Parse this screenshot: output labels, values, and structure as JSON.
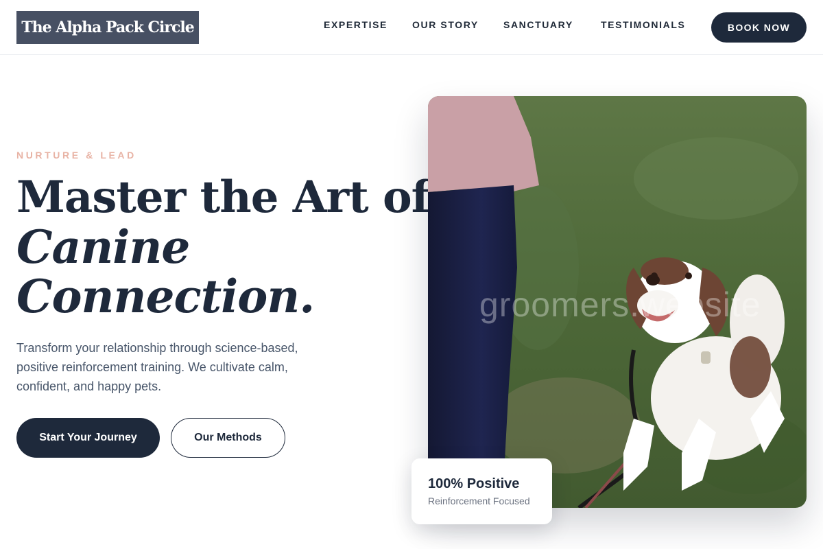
{
  "header": {
    "logo_text": "The Alpha Pack Circle",
    "nav": [
      "EXPERTISE",
      "OUR STORY",
      "SANCTUARY",
      "TESTIMONIALS"
    ],
    "cta_label": "BOOK NOW"
  },
  "hero": {
    "eyebrow": "NURTURE & LEAD",
    "headline_line1": "Master the Art of",
    "headline_italic_1": "Canine",
    "headline_italic_2": "Connection.",
    "description": "Transform your relationship through science-based, positive reinforcement training. We cultivate calm, confident, and happy pets.",
    "primary_button": "Start Your Journey",
    "secondary_button": "Our Methods",
    "image_watermark": "groomers.website"
  },
  "badge": {
    "title": "100% Positive",
    "subtitle": "Reinforcement Focused"
  },
  "colors": {
    "navy": "#1e293b",
    "logo_bg": "#475063",
    "eyebrow": "#e8b3a5",
    "grass": "#4f6b3a"
  }
}
